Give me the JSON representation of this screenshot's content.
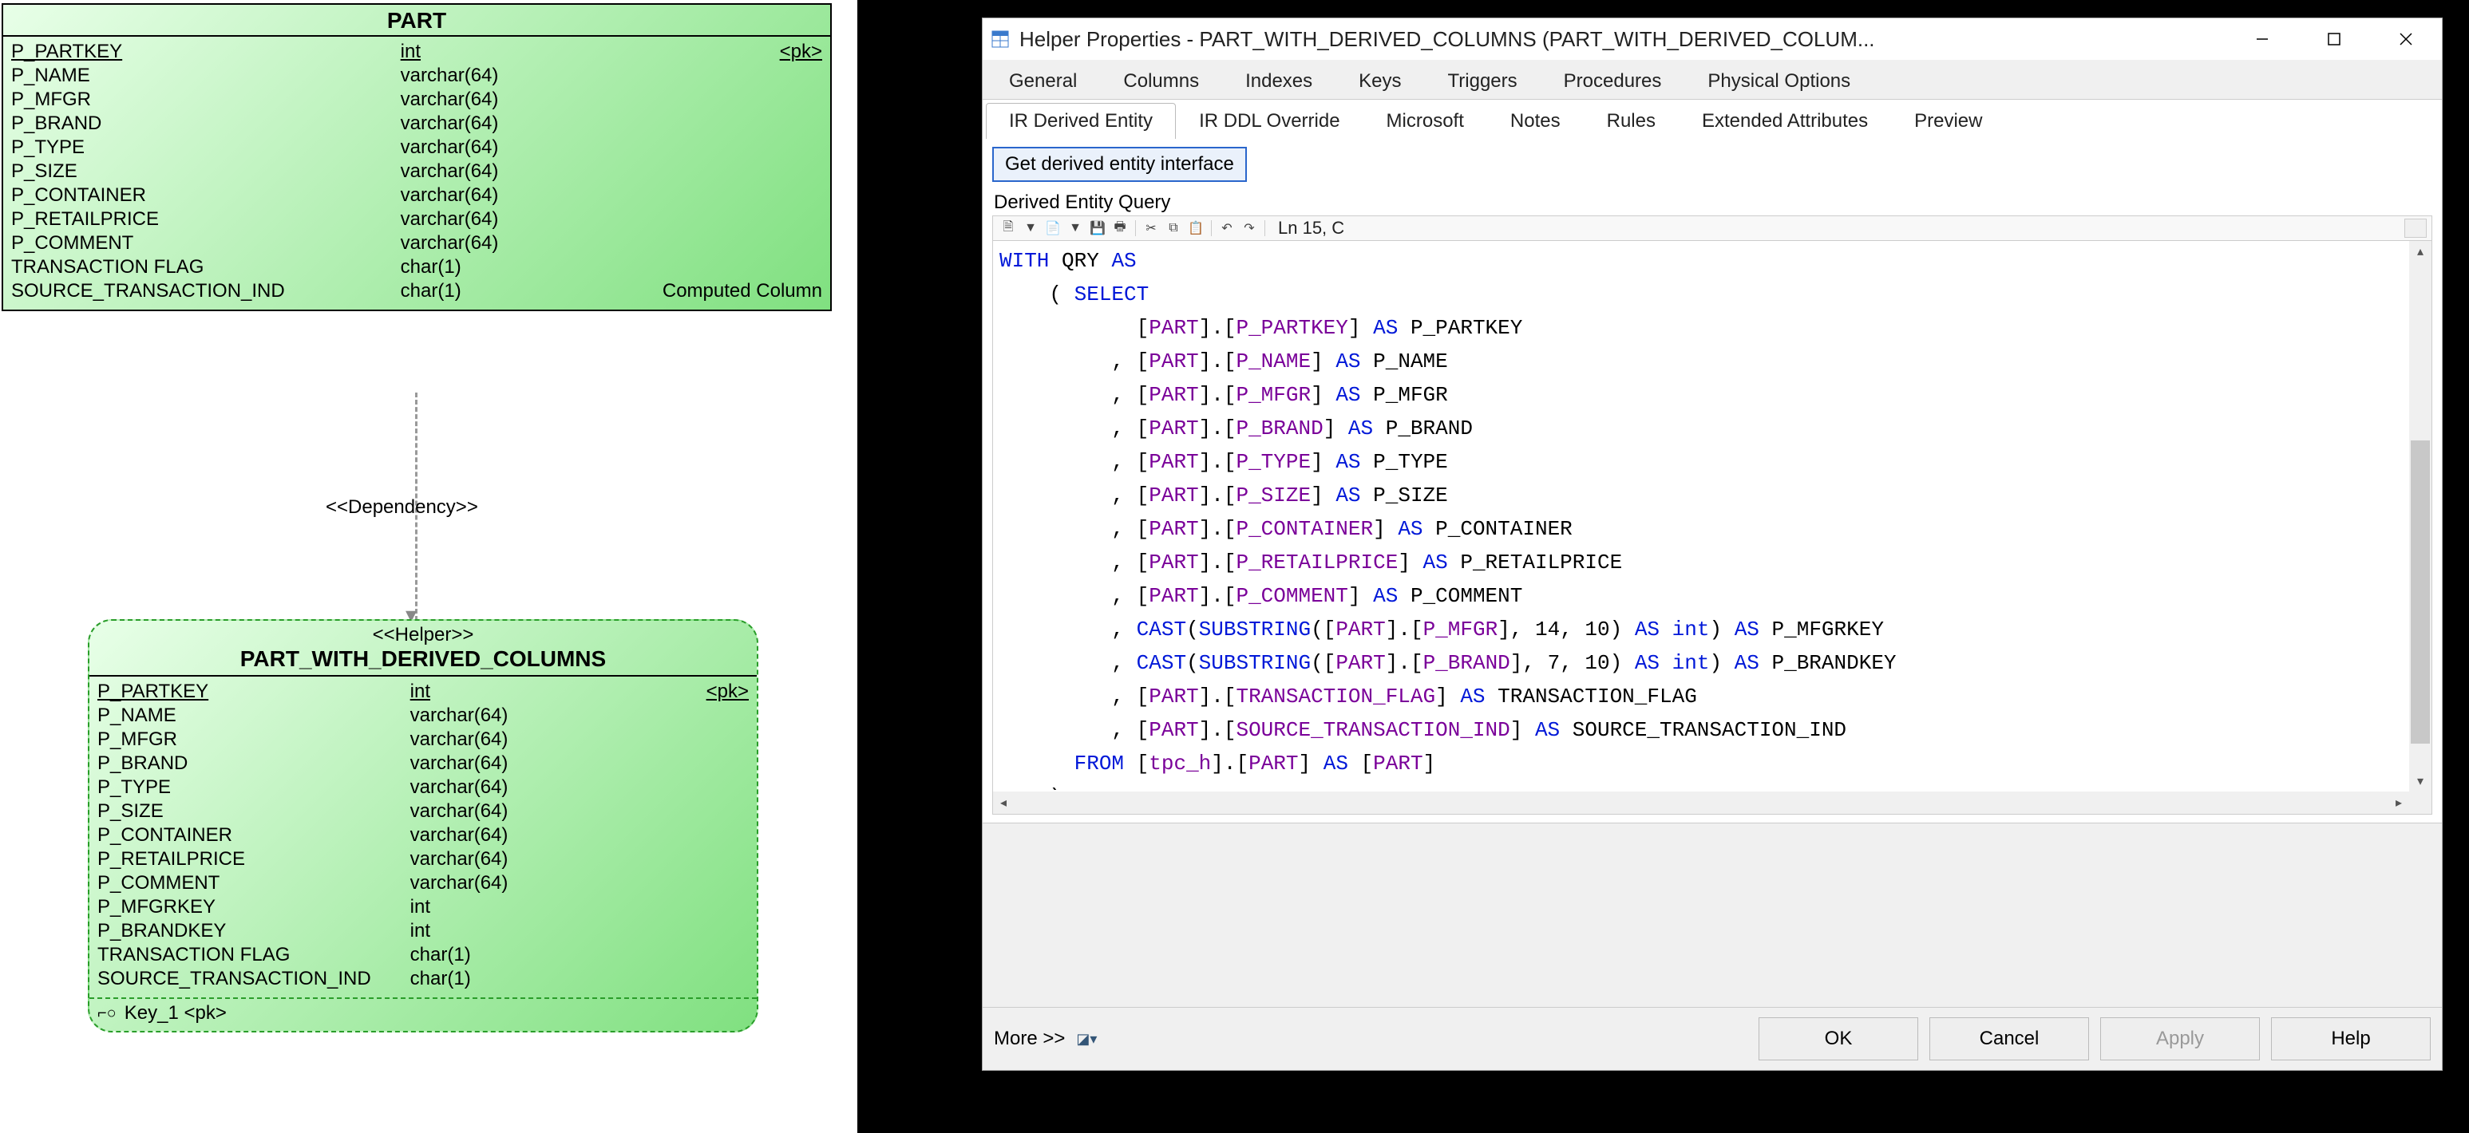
{
  "entity1": {
    "title": "PART",
    "cols": [
      {
        "name": "P_PARTKEY",
        "type": "int",
        "extra": "<pk>",
        "underline": true
      },
      {
        "name": "P_NAME",
        "type": "varchar(64)",
        "extra": ""
      },
      {
        "name": "P_MFGR",
        "type": "varchar(64)",
        "extra": ""
      },
      {
        "name": "P_BRAND",
        "type": "varchar(64)",
        "extra": ""
      },
      {
        "name": "P_TYPE",
        "type": "varchar(64)",
        "extra": ""
      },
      {
        "name": "P_SIZE",
        "type": "varchar(64)",
        "extra": ""
      },
      {
        "name": "P_CONTAINER",
        "type": "varchar(64)",
        "extra": ""
      },
      {
        "name": "P_RETAILPRICE",
        "type": "varchar(64)",
        "extra": ""
      },
      {
        "name": "P_COMMENT",
        "type": "varchar(64)",
        "extra": ""
      },
      {
        "name": "TRANSACTION FLAG",
        "type": "char(1)",
        "extra": ""
      },
      {
        "name": "SOURCE_TRANSACTION_IND",
        "type": "char(1)",
        "extra": "Computed Column"
      }
    ]
  },
  "dependency_label": "<<Dependency>>",
  "entity2": {
    "stereo": "<<Helper>>",
    "title": "PART_WITH_DERIVED_COLUMNS",
    "cols": [
      {
        "name": "P_PARTKEY",
        "type": "int",
        "extra": "<pk>",
        "underline": true
      },
      {
        "name": "P_NAME",
        "type": "varchar(64)",
        "extra": ""
      },
      {
        "name": "P_MFGR",
        "type": "varchar(64)",
        "extra": ""
      },
      {
        "name": "P_BRAND",
        "type": "varchar(64)",
        "extra": ""
      },
      {
        "name": "P_TYPE",
        "type": "varchar(64)",
        "extra": ""
      },
      {
        "name": "P_SIZE",
        "type": "varchar(64)",
        "extra": ""
      },
      {
        "name": "P_CONTAINER",
        "type": "varchar(64)",
        "extra": ""
      },
      {
        "name": "P_RETAILPRICE",
        "type": "varchar(64)",
        "extra": ""
      },
      {
        "name": "P_COMMENT",
        "type": "varchar(64)",
        "extra": ""
      },
      {
        "name": "P_MFGRKEY",
        "type": "int",
        "extra": ""
      },
      {
        "name": "P_BRANDKEY",
        "type": "int",
        "extra": ""
      },
      {
        "name": "TRANSACTION FLAG",
        "type": "char(1)",
        "extra": ""
      },
      {
        "name": "SOURCE_TRANSACTION_IND",
        "type": "char(1)",
        "extra": ""
      }
    ],
    "key_footer": "Key_1  <pk>"
  },
  "dialog": {
    "title": "Helper Properties - PART_WITH_DERIVED_COLUMNS (PART_WITH_DERIVED_COLUM...",
    "tabs_row1": [
      "General",
      "Columns",
      "Indexes",
      "Keys",
      "Triggers",
      "Procedures",
      "Physical Options"
    ],
    "tabs_row2": [
      "IR Derived Entity",
      "IR DDL Override",
      "Microsoft",
      "Notes",
      "Rules",
      "Extended Attributes",
      "Preview"
    ],
    "active_tab": "IR Derived Entity",
    "action_button": "Get derived entity interface",
    "section_label": "Derived Entity Query",
    "editor_status": "Ln 15, C",
    "sql_tokens": [
      [
        [
          "kw",
          "WITH"
        ],
        [
          "tx",
          " QRY "
        ],
        [
          "kw",
          "AS"
        ]
      ],
      [
        [
          "tx",
          "    ( "
        ],
        [
          "kw",
          "SELECT"
        ]
      ],
      [
        [
          "tx",
          "           ["
        ],
        [
          "id",
          "PART"
        ],
        [
          "tx",
          "].["
        ],
        [
          "id",
          "P_PARTKEY"
        ],
        [
          "tx",
          "] "
        ],
        [
          "kw",
          "AS"
        ],
        [
          "tx",
          " P_PARTKEY"
        ]
      ],
      [
        [
          "tx",
          "         , ["
        ],
        [
          "id",
          "PART"
        ],
        [
          "tx",
          "].["
        ],
        [
          "id",
          "P_NAME"
        ],
        [
          "tx",
          "] "
        ],
        [
          "kw",
          "AS"
        ],
        [
          "tx",
          " P_NAME"
        ]
      ],
      [
        [
          "tx",
          "         , ["
        ],
        [
          "id",
          "PART"
        ],
        [
          "tx",
          "].["
        ],
        [
          "id",
          "P_MFGR"
        ],
        [
          "tx",
          "] "
        ],
        [
          "kw",
          "AS"
        ],
        [
          "tx",
          " P_MFGR"
        ]
      ],
      [
        [
          "tx",
          "         , ["
        ],
        [
          "id",
          "PART"
        ],
        [
          "tx",
          "].["
        ],
        [
          "id",
          "P_BRAND"
        ],
        [
          "tx",
          "] "
        ],
        [
          "kw",
          "AS"
        ],
        [
          "tx",
          " P_BRAND"
        ]
      ],
      [
        [
          "tx",
          "         , ["
        ],
        [
          "id",
          "PART"
        ],
        [
          "tx",
          "].["
        ],
        [
          "id",
          "P_TYPE"
        ],
        [
          "tx",
          "] "
        ],
        [
          "kw",
          "AS"
        ],
        [
          "tx",
          " P_TYPE"
        ]
      ],
      [
        [
          "tx",
          "         , ["
        ],
        [
          "id",
          "PART"
        ],
        [
          "tx",
          "].["
        ],
        [
          "id",
          "P_SIZE"
        ],
        [
          "tx",
          "] "
        ],
        [
          "kw",
          "AS"
        ],
        [
          "tx",
          " P_SIZE"
        ]
      ],
      [
        [
          "tx",
          "         , ["
        ],
        [
          "id",
          "PART"
        ],
        [
          "tx",
          "].["
        ],
        [
          "id",
          "P_CONTAINER"
        ],
        [
          "tx",
          "] "
        ],
        [
          "kw",
          "AS"
        ],
        [
          "tx",
          " P_CONTAINER"
        ]
      ],
      [
        [
          "tx",
          "         , ["
        ],
        [
          "id",
          "PART"
        ],
        [
          "tx",
          "].["
        ],
        [
          "id",
          "P_RETAILPRICE"
        ],
        [
          "tx",
          "] "
        ],
        [
          "kw",
          "AS"
        ],
        [
          "tx",
          " P_RETAILPRICE"
        ]
      ],
      [
        [
          "tx",
          "         , ["
        ],
        [
          "id",
          "PART"
        ],
        [
          "tx",
          "].["
        ],
        [
          "id",
          "P_COMMENT"
        ],
        [
          "tx",
          "] "
        ],
        [
          "kw",
          "AS"
        ],
        [
          "tx",
          " P_COMMENT"
        ]
      ],
      [
        [
          "tx",
          "         , "
        ],
        [
          "kw",
          "CAST"
        ],
        [
          "tx",
          "("
        ],
        [
          "kw",
          "SUBSTRING"
        ],
        [
          "tx",
          "(["
        ],
        [
          "id",
          "PART"
        ],
        [
          "tx",
          "].["
        ],
        [
          "id",
          "P_MFGR"
        ],
        [
          "tx",
          "], 14, 10) "
        ],
        [
          "kw",
          "AS"
        ],
        [
          "tx",
          " "
        ],
        [
          "kw",
          "int"
        ],
        [
          "tx",
          ") "
        ],
        [
          "kw",
          "AS"
        ],
        [
          "tx",
          " P_MFGRKEY"
        ]
      ],
      [
        [
          "tx",
          "         , "
        ],
        [
          "kw",
          "CAST"
        ],
        [
          "tx",
          "("
        ],
        [
          "kw",
          "SUBSTRING"
        ],
        [
          "tx",
          "(["
        ],
        [
          "id",
          "PART"
        ],
        [
          "tx",
          "].["
        ],
        [
          "id",
          "P_BRAND"
        ],
        [
          "tx",
          "], 7, 10) "
        ],
        [
          "kw",
          "AS"
        ],
        [
          "tx",
          " "
        ],
        [
          "kw",
          "int"
        ],
        [
          "tx",
          ") "
        ],
        [
          "kw",
          "AS"
        ],
        [
          "tx",
          " P_BRANDKEY"
        ]
      ],
      [
        [
          "tx",
          "         , ["
        ],
        [
          "id",
          "PART"
        ],
        [
          "tx",
          "].["
        ],
        [
          "id",
          "TRANSACTION_FLAG"
        ],
        [
          "tx",
          "] "
        ],
        [
          "kw",
          "AS"
        ],
        [
          "tx",
          " TRANSACTION_FLAG"
        ]
      ],
      [
        [
          "tx",
          "         , ["
        ],
        [
          "id",
          "PART"
        ],
        [
          "tx",
          "].["
        ],
        [
          "id",
          "SOURCE_TRANSACTION_IND"
        ],
        [
          "tx",
          "] "
        ],
        [
          "kw",
          "AS"
        ],
        [
          "tx",
          " SOURCE_TRANSACTION_IND"
        ]
      ],
      [
        [
          "tx",
          "      "
        ],
        [
          "kw",
          "FROM"
        ],
        [
          "tx",
          " ["
        ],
        [
          "id",
          "tpc_h"
        ],
        [
          "tx",
          "].["
        ],
        [
          "id",
          "PART"
        ],
        [
          "tx",
          "] "
        ],
        [
          "kw",
          "AS"
        ],
        [
          "tx",
          " ["
        ],
        [
          "id",
          "PART"
        ],
        [
          "tx",
          "]"
        ]
      ],
      [
        [
          "tx",
          "    )"
        ]
      ]
    ],
    "footer": {
      "more": "More >>",
      "ok": "OK",
      "cancel": "Cancel",
      "apply": "Apply",
      "help": "Help"
    }
  }
}
